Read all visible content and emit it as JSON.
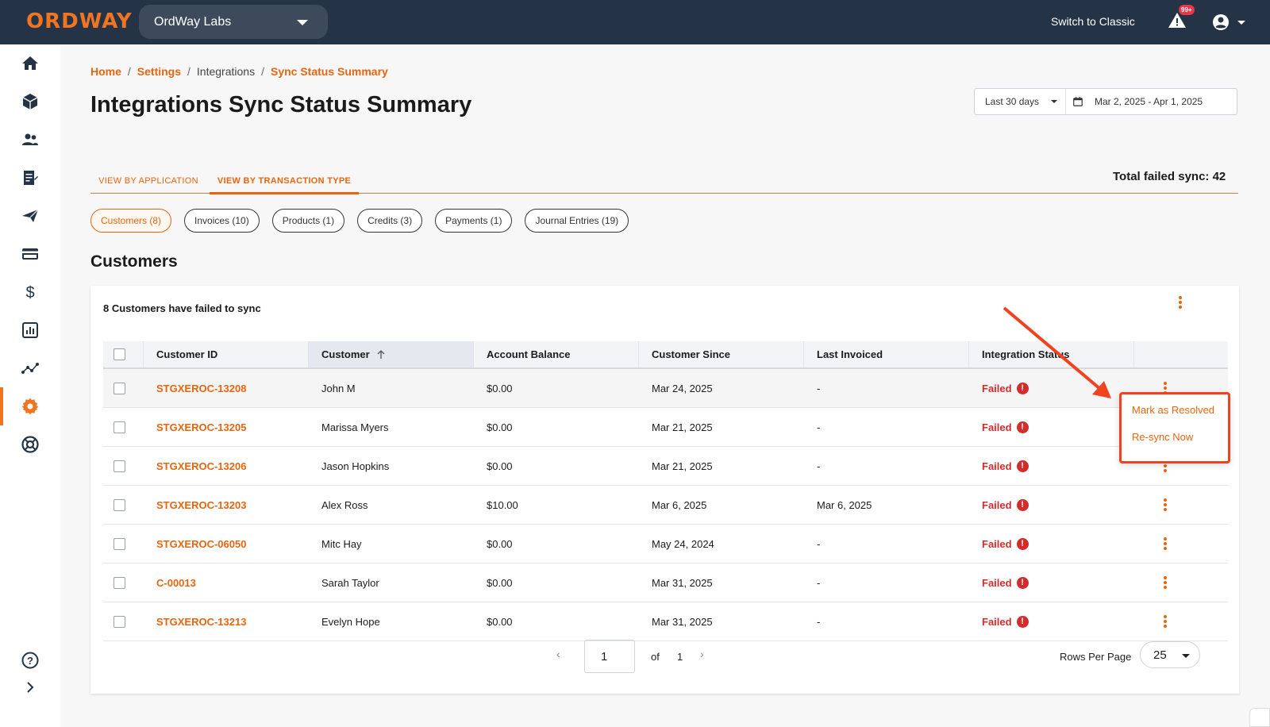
{
  "topbar": {
    "logo": "ORDWAY",
    "org_name": "OrdWay Labs",
    "switch_label": "Switch to Classic",
    "alert_count": "99+"
  },
  "sidebar": {
    "items": [
      {
        "icon": "home-icon"
      },
      {
        "icon": "box-icon"
      },
      {
        "icon": "customers-icon"
      },
      {
        "icon": "contracts-icon"
      },
      {
        "icon": "send-icon"
      },
      {
        "icon": "card-icon"
      },
      {
        "icon": "dollar-icon"
      },
      {
        "icon": "reports-icon"
      },
      {
        "icon": "analytics-icon"
      },
      {
        "icon": "settings-icon",
        "active": true
      },
      {
        "icon": "support-icon"
      }
    ],
    "bottom": [
      {
        "icon": "help-icon"
      },
      {
        "icon": "expand-icon"
      }
    ]
  },
  "breadcrumb": {
    "home": "Home",
    "settings": "Settings",
    "integrations": "Integrations",
    "current": "Sync Status Summary",
    "sep": "/"
  },
  "page_title": "Integrations Sync Status Summary",
  "date_range": {
    "preset": "Last 30 days",
    "range": "Mar 2, 2025 - Apr 1, 2025"
  },
  "tabs": [
    {
      "label": "VIEW BY APPLICATION",
      "active": false
    },
    {
      "label": "VIEW BY TRANSACTION TYPE",
      "active": true
    }
  ],
  "total_failed": "Total failed sync: 42",
  "chips": [
    {
      "label": "Customers (8)",
      "active": true
    },
    {
      "label": "Invoices (10)",
      "active": false
    },
    {
      "label": "Products (1)",
      "active": false
    },
    {
      "label": "Credits (3)",
      "active": false
    },
    {
      "label": "Payments (1)",
      "active": false
    },
    {
      "label": "Journal Entries (19)",
      "active": false
    }
  ],
  "section_title": "Customers",
  "card_subtitle": "8 Customers have failed to sync",
  "table": {
    "columns": [
      "Customer ID",
      "Customer",
      "Account Balance",
      "Customer Since",
      "Last Invoiced",
      "Integration Status"
    ],
    "rows": [
      {
        "id": "STGXEROC-13208",
        "customer": "John M",
        "balance": "$0.00",
        "since": "Mar 24, 2025",
        "last_invoiced": "-",
        "status": "Failed"
      },
      {
        "id": "STGXEROC-13205",
        "customer": "Marissa Myers",
        "balance": "$0.00",
        "since": "Mar 21, 2025",
        "last_invoiced": "-",
        "status": "Failed"
      },
      {
        "id": "STGXEROC-13206",
        "customer": "Jason Hopkins",
        "balance": "$0.00",
        "since": "Mar 21, 2025",
        "last_invoiced": "-",
        "status": "Failed"
      },
      {
        "id": "STGXEROC-13203",
        "customer": "Alex Ross",
        "balance": "$10.00",
        "since": "Mar 6, 2025",
        "last_invoiced": "Mar 6, 2025",
        "status": "Failed"
      },
      {
        "id": "STGXEROC-06050",
        "customer": "Mitc Hay",
        "balance": "$0.00",
        "since": "May 24, 2024",
        "last_invoiced": "-",
        "status": "Failed"
      },
      {
        "id": "C-00013",
        "customer": "Sarah Taylor",
        "balance": "$0.00",
        "since": "Mar 31, 2025",
        "last_invoiced": "-",
        "status": "Failed"
      },
      {
        "id": "STGXEROC-13213",
        "customer": "Evelyn Hope",
        "balance": "$0.00",
        "since": "Mar 31, 2025",
        "last_invoiced": "-",
        "status": "Failed"
      }
    ]
  },
  "row_menu": {
    "mark_resolved": "Mark as Resolved",
    "resync": "Re-sync Now"
  },
  "pagination": {
    "page": "1",
    "of_label": "of",
    "total_pages": "1",
    "rows_per_page_label": "Rows Per Page",
    "rows_per_page": "25"
  },
  "colors": {
    "accent": "#e8650f",
    "topbar": "#243446",
    "failed": "#d42b2b",
    "annotation": "#f0421f"
  }
}
